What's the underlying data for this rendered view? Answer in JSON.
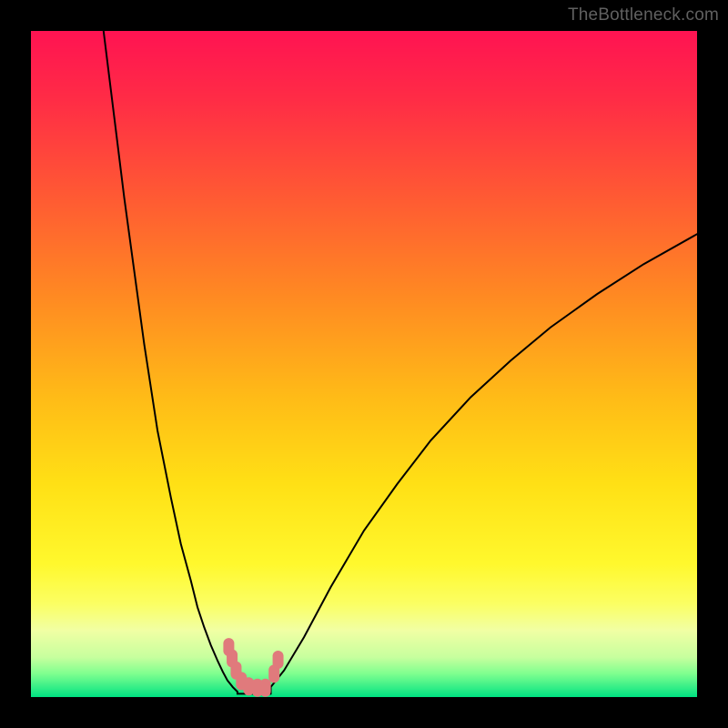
{
  "watermark": "TheBottleneck.com",
  "colors": {
    "gradient": [
      {
        "offset": 0.0,
        "hex": "#ff1352"
      },
      {
        "offset": 0.1,
        "hex": "#ff2b46"
      },
      {
        "offset": 0.25,
        "hex": "#ff5a33"
      },
      {
        "offset": 0.4,
        "hex": "#ff8a22"
      },
      {
        "offset": 0.55,
        "hex": "#ffbb17"
      },
      {
        "offset": 0.68,
        "hex": "#ffe015"
      },
      {
        "offset": 0.8,
        "hex": "#fff82d"
      },
      {
        "offset": 0.86,
        "hex": "#fbff63"
      },
      {
        "offset": 0.9,
        "hex": "#f1ffa4"
      },
      {
        "offset": 0.94,
        "hex": "#c7ff9e"
      },
      {
        "offset": 0.965,
        "hex": "#7fff8f"
      },
      {
        "offset": 1.0,
        "hex": "#00e282"
      }
    ],
    "curve": "#000000",
    "marker": "#e07a7c"
  },
  "chart_data": {
    "type": "line",
    "title": "",
    "xlabel": "",
    "ylabel": "",
    "xlim": [
      0,
      100
    ],
    "ylim": [
      0,
      100
    ],
    "series": [
      {
        "name": "left-curve",
        "x": [
          10.9,
          14.0,
          17.0,
          19.0,
          21.0,
          22.5,
          24.0,
          25.0,
          26.0,
          27.0,
          28.0,
          28.8,
          29.5,
          30.3,
          31.0
        ],
        "values": [
          100.0,
          75.0,
          53.0,
          40.0,
          30.0,
          23.0,
          17.5,
          13.5,
          10.5,
          7.8,
          5.5,
          3.8,
          2.5,
          1.5,
          0.8
        ]
      },
      {
        "name": "right-curve",
        "x": [
          36.0,
          38.0,
          41.0,
          45.0,
          50.0,
          55.0,
          60.0,
          66.0,
          72.0,
          78.0,
          85.0,
          92.0,
          100.0
        ],
        "values": [
          1.5,
          4.0,
          9.0,
          16.5,
          25.0,
          32.0,
          38.5,
          45.0,
          50.5,
          55.5,
          60.5,
          65.0,
          69.5
        ]
      }
    ],
    "valley_floor": {
      "x_range": [
        31.0,
        36.0
      ],
      "value": 0.5
    },
    "markers": [
      {
        "x": 29.7,
        "y": 7.5
      },
      {
        "x": 30.2,
        "y": 5.8
      },
      {
        "x": 30.8,
        "y": 4.0
      },
      {
        "x": 31.6,
        "y": 2.4
      },
      {
        "x": 32.7,
        "y": 1.6
      },
      {
        "x": 34.0,
        "y": 1.4
      },
      {
        "x": 35.2,
        "y": 1.4
      },
      {
        "x": 36.5,
        "y": 3.5
      },
      {
        "x": 37.1,
        "y": 5.6
      }
    ]
  }
}
